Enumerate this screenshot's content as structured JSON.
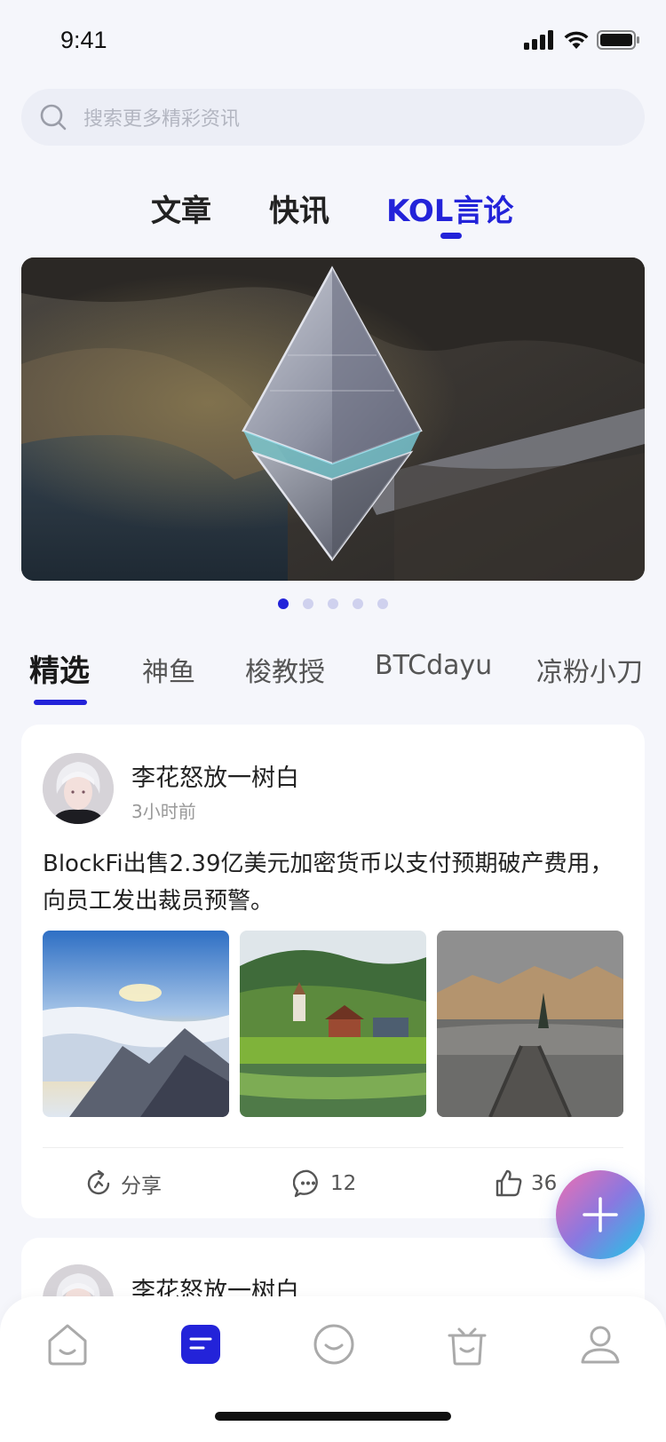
{
  "status_bar": {
    "time": "9:41"
  },
  "search": {
    "placeholder": "搜索更多精彩资讯"
  },
  "main_tabs": [
    {
      "label": "文章",
      "active": false
    },
    {
      "label": "快讯",
      "active": false
    },
    {
      "label": "KOL言论",
      "active": true
    }
  ],
  "banner": {
    "slide_count": 5,
    "active_index": 0
  },
  "sub_tabs": [
    {
      "label": "精选",
      "active": true
    },
    {
      "label": "神鱼",
      "active": false
    },
    {
      "label": "梭教授",
      "active": false
    },
    {
      "label": "BTCdayu",
      "active": false
    },
    {
      "label": "凉粉小刀",
      "active": false
    }
  ],
  "post": {
    "author": "李花怒放一树白",
    "time": "3小时前",
    "text": "BlockFi出售2.39亿美元加密货币以支付预期破产费用，向员工发出裁员预警。",
    "share_label": "分享",
    "comment_count": "12",
    "like_count": "36"
  },
  "post_2": {
    "author": "李花怒放一树白"
  },
  "bottom_nav": [
    "home",
    "articles",
    "smile",
    "shop",
    "profile"
  ],
  "colors": {
    "accent": "#2323d9",
    "background": "#f5f6fb"
  }
}
